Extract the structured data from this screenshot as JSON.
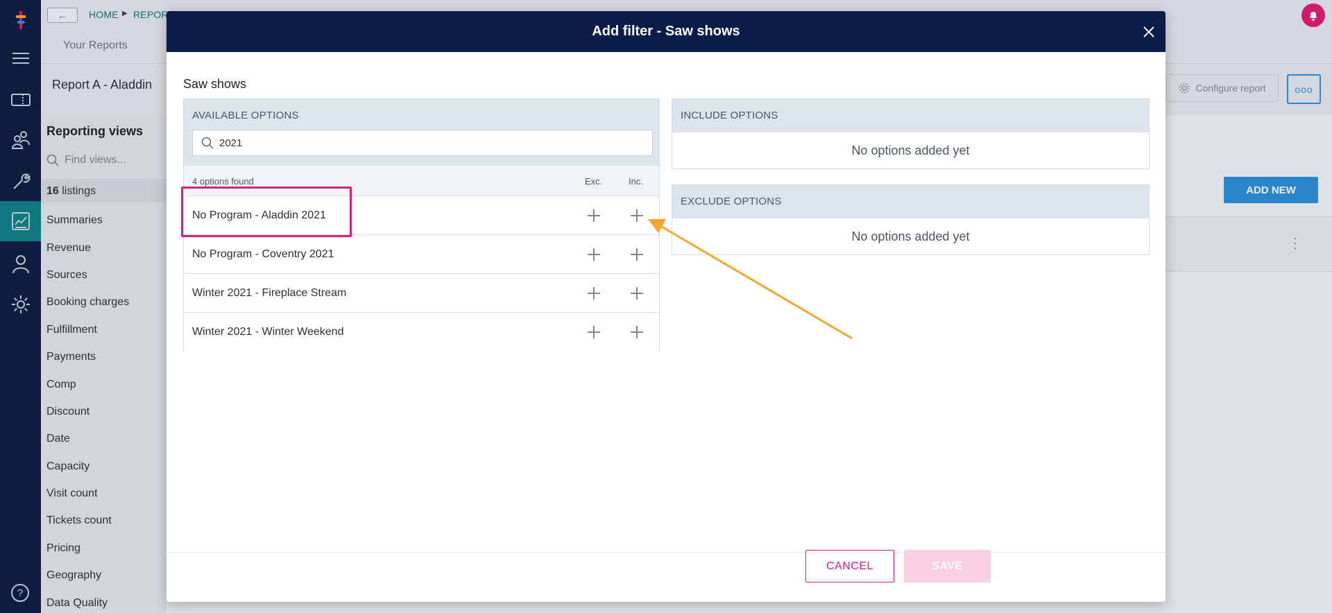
{
  "breadcrumb": {
    "home": "HOME",
    "reports": "REPORTS"
  },
  "tabs": {
    "your_reports": "Your Reports"
  },
  "report": {
    "title": "Report A - Aladdin",
    "configure_label": "Configure report",
    "more_label": "ooo"
  },
  "sidebar": {
    "title": "Reporting views",
    "search_placeholder": "Find views...",
    "count_number": "16",
    "count_label": " listings",
    "items": [
      "Summaries",
      "Revenue",
      "Sources",
      "Booking charges",
      "Fulfillment",
      "Payments",
      "Comp",
      "Discount",
      "Date",
      "Capacity",
      "Visit count",
      "Tickets count",
      "Pricing",
      "Geography",
      "Data Quality"
    ]
  },
  "main": {
    "add_new_label": "ADD NEW"
  },
  "modal": {
    "title": "Add filter - Saw shows",
    "subtitle": "Saw shows",
    "available": {
      "header": "AVAILABLE OPTIONS",
      "search_value": "2021",
      "found_text": "4 options found",
      "col_exc": "Exc.",
      "col_inc": "Inc.",
      "options": [
        "No Program - Aladdin 2021",
        "No Program - Coventry 2021",
        "Winter 2021 - Fireplace Stream",
        "Winter 2021 - Winter Weekend"
      ]
    },
    "include": {
      "header": "INCLUDE OPTIONS",
      "empty": "No options added yet"
    },
    "exclude": {
      "header": "EXCLUDE OPTIONS",
      "empty": "No options added yet"
    },
    "cancel_label": "CANCEL",
    "save_label": "SAVE"
  },
  "colors": {
    "nav": "#0c1c3f",
    "modal_header": "#0c1c4a",
    "accent_pink": "#d6217a",
    "accent_blue": "#2a8cd8",
    "arrow": "#f5a52a",
    "active_nav": "#0c7d86"
  },
  "icons": [
    "app-logo-icon",
    "menu-icon",
    "ticket-icon",
    "people-icon",
    "wrench-icon",
    "report-icon",
    "user-icon",
    "gear-icon",
    "help-icon",
    "bell-icon",
    "search-icon",
    "close-icon",
    "back-arrow-icon",
    "plus-icon"
  ]
}
